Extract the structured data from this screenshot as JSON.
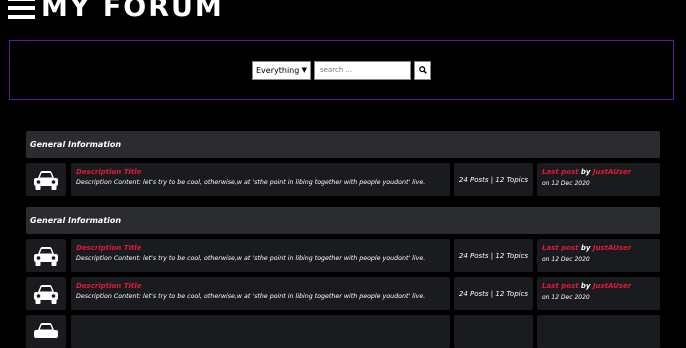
{
  "header": {
    "logo": "MY FORUM"
  },
  "search": {
    "select_value": "Everything",
    "placeholder": "search ..."
  },
  "sections": [
    {
      "title": "General Information",
      "rows": [
        {
          "title": "Description Title",
          "content": "Description Content: let's try to be cool, otherwise,w at 'sthe point in libing together with people youdont' live.",
          "stats": "24 Posts | 12 Topics",
          "last_label": "Last post",
          "last_by": "by",
          "last_user": "JustAUser",
          "last_date": "on 12 Dec 2020"
        }
      ]
    },
    {
      "title": "General Information",
      "rows": [
        {
          "title": "Description Title",
          "content": "Description Content: let's try to be cool, otherwise,w at 'sthe point in libing together with people youdont' live.",
          "stats": "24 Posts | 12 Topics",
          "last_label": "Last post",
          "last_by": "by",
          "last_user": "JustAUser",
          "last_date": "on 12 Dec 2020"
        },
        {
          "title": "Description Title",
          "content": "Description Content: let's try to be cool, otherwise,w at 'sthe point in libing together with people youdont' live.",
          "stats": "24 Posts | 12 Topics",
          "last_label": "Last post",
          "last_by": "by",
          "last_user": "JustAUser",
          "last_date": "on 12 Dec 2020"
        },
        {}
      ]
    }
  ],
  "icons": {
    "menu": "hamburger-menu-icon",
    "search": "search-icon",
    "row": "car-icon"
  }
}
